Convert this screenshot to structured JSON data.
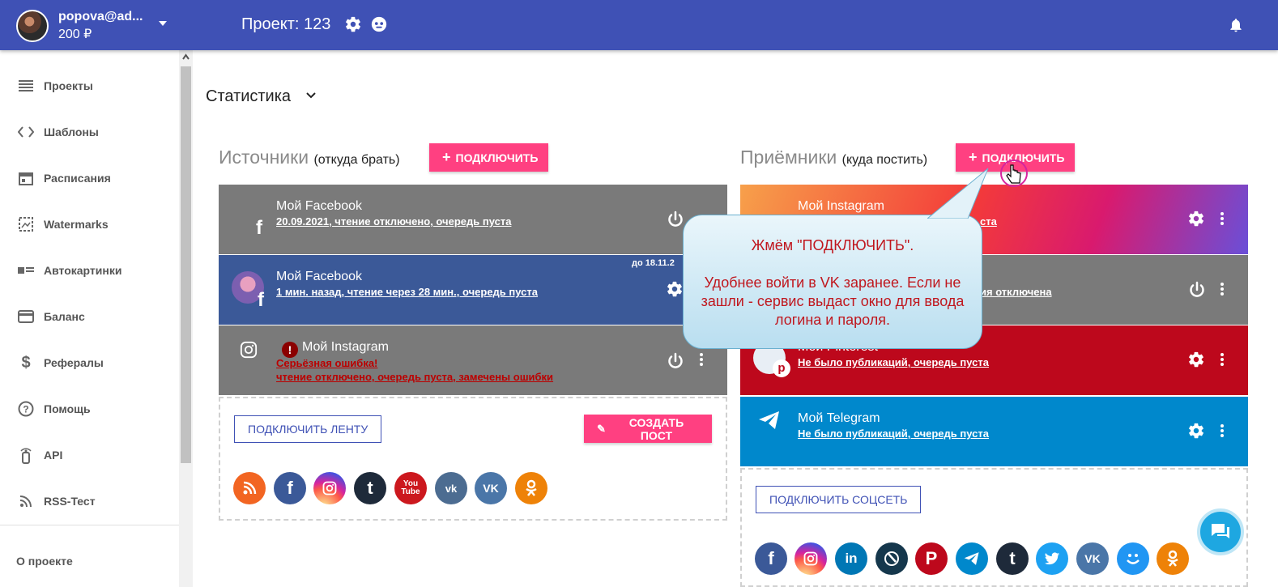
{
  "header": {
    "user_email": "popova@ad...",
    "balance": "200 ₽",
    "project_title": "Проект: 123",
    "accent_color": "#3f51b5"
  },
  "sidebar": {
    "items": [
      {
        "label": "Проекты",
        "icon": "list-icon"
      },
      {
        "label": "Шаблоны",
        "icon": "code-icon"
      },
      {
        "label": "Расписания",
        "icon": "calendar-icon"
      },
      {
        "label": "Watermarks",
        "icon": "watermark-icon"
      },
      {
        "label": "Автокартинки",
        "icon": "autopicture-icon"
      },
      {
        "label": "Баланс",
        "icon": "credit-card-icon"
      },
      {
        "label": "Рефералы",
        "icon": "dollar-icon"
      },
      {
        "label": "Помощь",
        "icon": "help-icon"
      },
      {
        "label": "API",
        "icon": "api-icon"
      },
      {
        "label": "RSS-Тест",
        "icon": "rss-icon"
      }
    ],
    "about": "О проекте"
  },
  "main": {
    "stats_title": "Статистика",
    "sources": {
      "title": "Источники",
      "subtitle": "(откуда брать)",
      "connect_label": "ПОДКЛЮЧИТЬ",
      "cards": [
        {
          "name": "Мой Facebook",
          "status": "20.09.2021, чтение отключено, очередь пуста",
          "color": "#7a7a7a"
        },
        {
          "name": "Мой Facebook",
          "status": "1 мин. назад, чтение через 28 мин., очередь пуста",
          "tag": "до 18.11.2",
          "color": "#3b5998"
        },
        {
          "name": "Мой Instagram",
          "status": "Серьёзная ошибка!",
          "status2": "чтение отключено, очередь пуста, замечены ошибки",
          "color": "#7a7a7a"
        }
      ],
      "connect_feed_label": "ПОДКЛЮЧИТЬ ЛЕНТУ",
      "create_post_label": "СОЗДАТЬ ПОСТ",
      "icons": [
        "rss-icon",
        "facebook-icon",
        "instagram-icon",
        "tumblr-icon",
        "youtube-icon",
        "vk-icon",
        "vk-icon",
        "odnoklassniki-icon"
      ]
    },
    "targets": {
      "title": "Приёмники",
      "subtitle": "(куда постить)",
      "connect_label": "ПОДКЛЮЧИТЬ",
      "cards": [
        {
          "name": "Мой Instagram",
          "status": "ста",
          "color": "#e1306c"
        },
        {
          "name": "",
          "status": "ия отключена",
          "color": "#7a7a7a"
        },
        {
          "name": "Мой Pinterest",
          "status": "Не было публикаций, очередь пуста",
          "color": "#bd081c"
        },
        {
          "name": "Мой Telegram",
          "status": "Не было публикаций, очередь пуста",
          "color": "#0088cc"
        }
      ],
      "connect_social_label": "ПОДКЛЮЧИТЬ СОЦСЕТЬ",
      "icons": [
        "facebook-icon",
        "instagram-icon",
        "linkedin-icon",
        "livejournal-icon",
        "pinterest-icon",
        "telegram-icon",
        "tumblr-icon",
        "twitter-icon",
        "vk-icon",
        "vk-smile-icon",
        "odnoklassniki-icon"
      ]
    }
  },
  "tooltip": {
    "line1": "Жмём \"ПОДКЛЮЧИТЬ\".",
    "line2": "Удобнее войти в VK заранее. Если не зашли - сервис выдаст окно для ввода логина и пароля."
  }
}
